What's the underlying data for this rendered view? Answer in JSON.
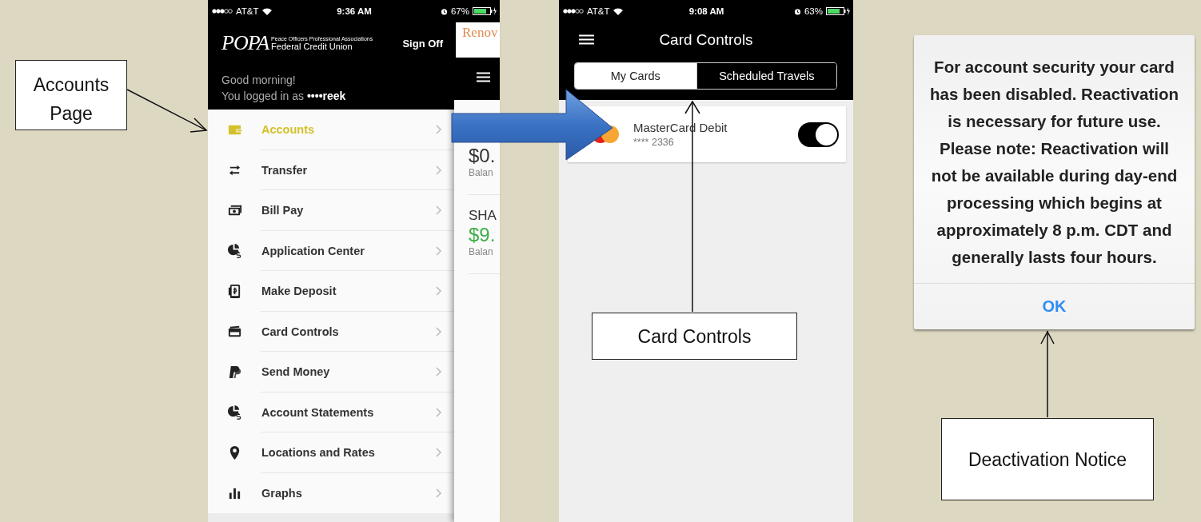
{
  "accounts_screen": {
    "status_bar": {
      "carrier": "AT&T",
      "time": "9:36 AM",
      "battery": "67%"
    },
    "logo": {
      "mark": "POPA",
      "tagline": "Peace Officers Professional Associations",
      "name": "Federal Credit Union"
    },
    "sign_off": "Sign Off",
    "greeting": "Good morning!",
    "login_line": "You logged in as **••••reek**",
    "menu": [
      {
        "label": "Accounts",
        "selected": true
      },
      {
        "label": "Transfer",
        "selected": false
      },
      {
        "label": "Bill Pay",
        "selected": false
      },
      {
        "label": "Application Center",
        "selected": false
      },
      {
        "label": "Make Deposit",
        "selected": false
      },
      {
        "label": "Card Controls",
        "selected": false
      },
      {
        "label": "Send Money",
        "selected": false
      },
      {
        "label": "Account Statements",
        "selected": false
      },
      {
        "label": "Locations and Rates",
        "selected": false
      },
      {
        "label": "Graphs",
        "selected": false
      }
    ],
    "behind": {
      "banner": "Renov",
      "accounts": [
        {
          "amount": "$0.",
          "label": "Balan"
        },
        {
          "title": "SHA",
          "amount": "$9.",
          "label": "Balan"
        }
      ]
    }
  },
  "card_controls_screen": {
    "status_bar": {
      "carrier": "AT&T",
      "time": "9:08 AM",
      "battery": "63%"
    },
    "title": "Card Controls",
    "tabs": [
      {
        "label": "My Cards",
        "selected": true
      },
      {
        "label": "Scheduled Travels",
        "selected": false
      }
    ],
    "cards": [
      {
        "name": "MasterCard Debit",
        "number": "**** 2336",
        "on": true
      }
    ]
  },
  "dialog": {
    "message": "For account security your card has been disabled. Reactivation is necessary for future use. Please note: Reactivation will not be available during day-end processing which begins at approximately 8 p.m. CDT and generally lasts four hours.",
    "button": "OK"
  },
  "annotations": [
    {
      "text": "Accounts Page"
    },
    {
      "text": "Card Controls"
    },
    {
      "text": "Deactivation Notice"
    }
  ]
}
